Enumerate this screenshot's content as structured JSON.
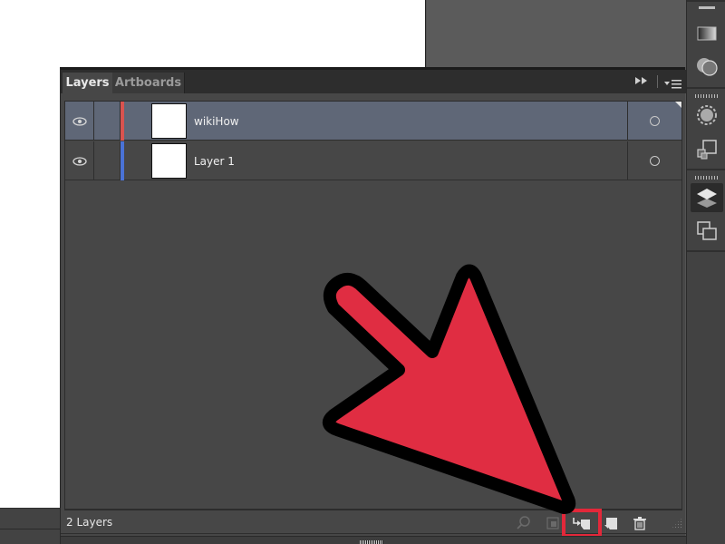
{
  "panel": {
    "tabs": [
      {
        "label": "Layers",
        "active": true
      },
      {
        "label": "Artboards",
        "active": false
      }
    ],
    "collapse_icon": "double-chevron-right-icon",
    "menu_icon": "panel-menu-icon"
  },
  "layers": [
    {
      "name": "wikiHow",
      "visible": true,
      "color": "#d9534f",
      "selected": true
    },
    {
      "name": "Layer 1",
      "visible": true,
      "color": "#4a72d6",
      "selected": false
    }
  ],
  "footer": {
    "layer_count": "2 Layers",
    "buttons": [
      {
        "name": "locate-object",
        "icon": "search-icon",
        "enabled": false
      },
      {
        "name": "make-clipping-mask",
        "icon": "clipping-mask-icon",
        "enabled": false
      },
      {
        "name": "create-new-sublayer",
        "icon": "new-sublayer-icon",
        "enabled": true,
        "highlighted": true
      },
      {
        "name": "create-new-layer",
        "icon": "new-layer-icon",
        "enabled": true
      },
      {
        "name": "delete-selection",
        "icon": "trash-icon",
        "enabled": true
      }
    ]
  },
  "dock": {
    "icons": [
      "gradient-icon",
      "transparency-icon",
      "appearance-icon",
      "transform-icon",
      "layers-icon",
      "artboards-icon"
    ],
    "active": "layers-icon"
  },
  "annotation": {
    "type": "arrow",
    "fill": "#e02d42",
    "stroke": "#000000",
    "highlight_color": "#e3283a"
  }
}
